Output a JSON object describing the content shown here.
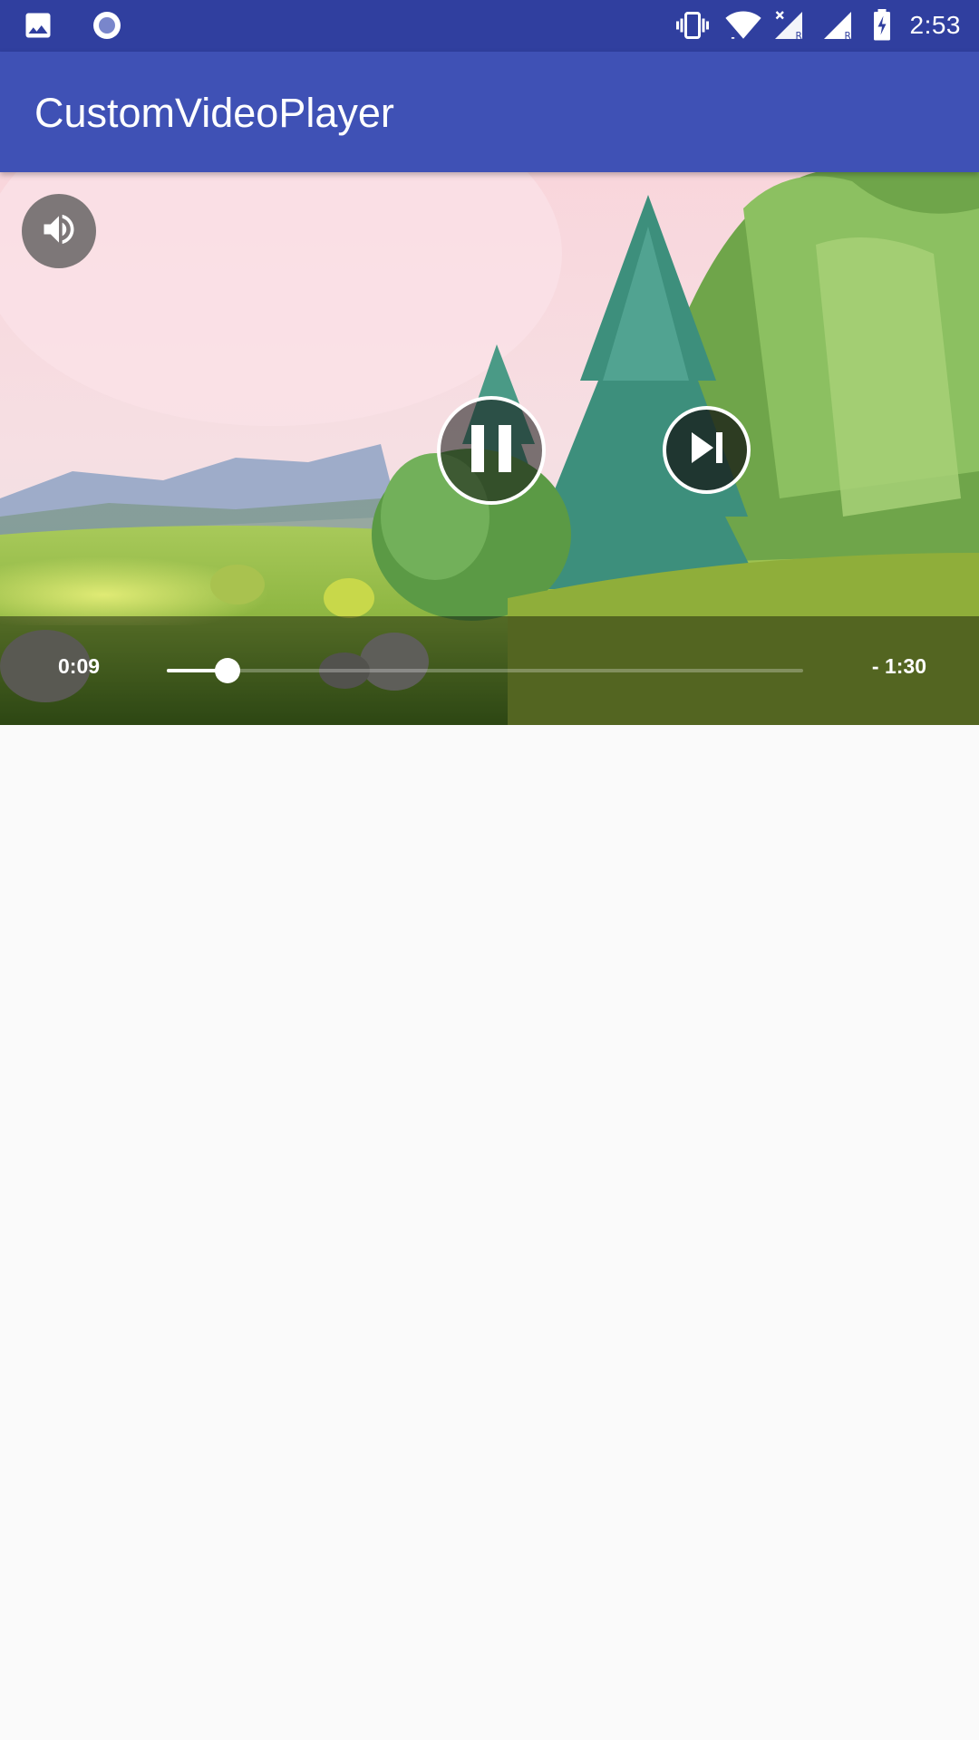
{
  "status_bar": {
    "left_icons": [
      "image-icon",
      "recording-icon"
    ],
    "right_icons": [
      "vibrate-icon",
      "wifi-icon",
      "signal-roaming-icon",
      "signal-roaming-icon",
      "battery-charging-icon"
    ],
    "time": "2:53"
  },
  "app_bar": {
    "title": "CustomVideoPlayer",
    "color": "#3f51b5",
    "status_color": "#303f9f"
  },
  "player": {
    "current_time": "0:09",
    "remaining_time": "- 1:30",
    "progress_fraction": 0.095,
    "icons": {
      "volume": "volume-icon",
      "pause": "pause-icon",
      "next": "skip-next-icon"
    }
  }
}
